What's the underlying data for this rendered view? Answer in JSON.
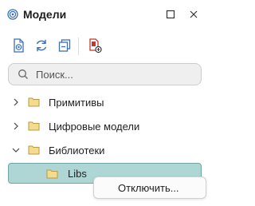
{
  "panel": {
    "title": "Модели",
    "logo_icon": "models-logo-icon",
    "maximize_icon": "maximize-icon",
    "close_icon": "close-icon"
  },
  "toolbar": {
    "buttons": [
      {
        "icon": "view-model-icon"
      },
      {
        "icon": "refresh-icon"
      },
      {
        "icon": "collapse-all-icon"
      },
      {
        "icon": "add-library-icon"
      }
    ]
  },
  "search": {
    "placeholder": "Поиск...",
    "value": ""
  },
  "tree": {
    "items": [
      {
        "label": "Примитивы",
        "expanded": false
      },
      {
        "label": "Цифровые модели",
        "expanded": false
      },
      {
        "label": "Библиотеки",
        "expanded": true
      },
      {
        "label": "Libs",
        "selected": true
      }
    ]
  },
  "context_menu": {
    "items": [
      "Отключить..."
    ]
  },
  "colors": {
    "selection_bg": "#aed6d4",
    "selection_border": "#6fa6a3",
    "folder": "#e6c36a",
    "accent_blue": "#3a6fb5",
    "accent_red": "#c0392b"
  }
}
